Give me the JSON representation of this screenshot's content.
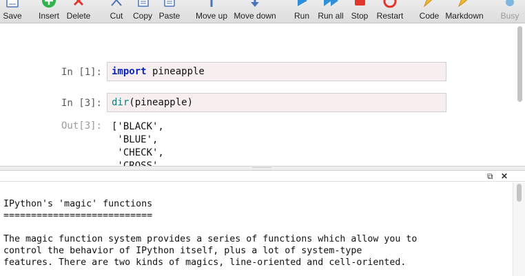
{
  "toolbar": {
    "buttons": [
      {
        "label": "Save",
        "icon": "save-icon"
      },
      {
        "label": "Insert",
        "icon": "plus-icon"
      },
      {
        "label": "Delete",
        "icon": "close-icon"
      },
      {
        "label": "Cut",
        "icon": "scissors-icon"
      },
      {
        "label": "Copy",
        "icon": "copy-icon"
      },
      {
        "label": "Paste",
        "icon": "paste-icon"
      },
      {
        "label": "Move up",
        "icon": "arrow-up-icon"
      },
      {
        "label": "Move down",
        "icon": "arrow-down-icon"
      },
      {
        "label": "Run",
        "icon": "play-icon"
      },
      {
        "label": "Run all",
        "icon": "fast-forward-icon"
      },
      {
        "label": "Stop",
        "icon": "stop-icon"
      },
      {
        "label": "Restart",
        "icon": "restart-icon"
      },
      {
        "label": "Code",
        "icon": "pencil-icon"
      },
      {
        "label": "Markdown",
        "icon": "markdown-icon"
      },
      {
        "label": "Busy",
        "icon": "busy-icon"
      }
    ]
  },
  "colors": {
    "insert_green": "#2fb34a",
    "delete_red": "#e0362c",
    "run_blue": "#2f8fd8",
    "stop_red": "#e0362c",
    "prompt_gray": "#5a5a5a",
    "cell_bg": "#f7efef"
  },
  "notebook": {
    "cells": [
      {
        "prompt": "In [1]:",
        "keyword": "import",
        "rest": " pineapple"
      },
      {
        "prompt": "In [3]:",
        "keyword": "dir",
        "rest": "(pineapple)"
      }
    ],
    "output": {
      "prompt": "Out[3]:",
      "text": "['BLACK',\n 'BLUE',\n 'CHECK',\n 'CROSS',"
    }
  },
  "help": {
    "text": "IPython's 'magic' functions\n===========================\n\nThe magic function system provides a series of functions which allow you to\ncontrol the behavior of IPython itself, plus a lot of system-type\nfeatures. There are two kinds of magics, line-oriented and cell-oriented."
  }
}
